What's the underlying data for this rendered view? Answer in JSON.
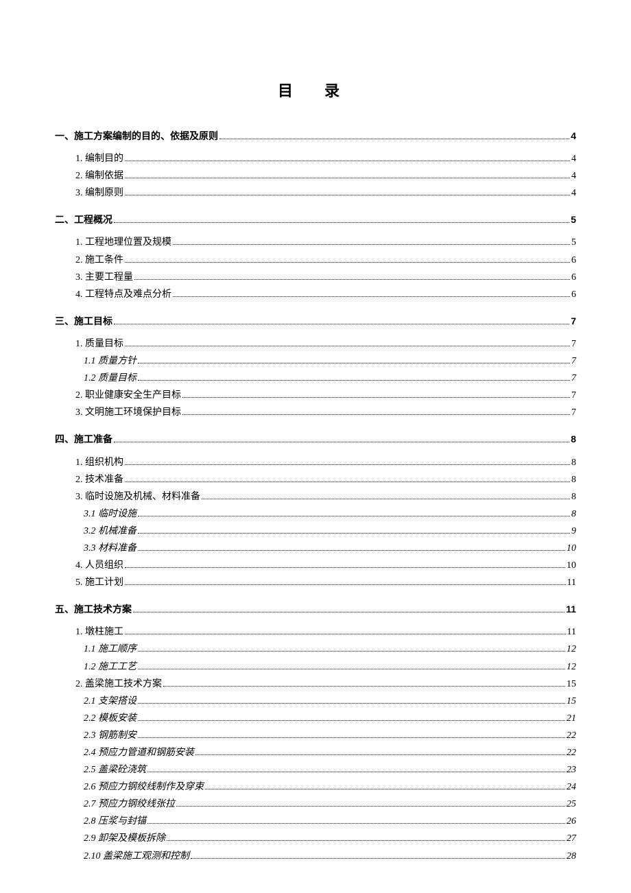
{
  "title": "目 录",
  "toc": [
    {
      "level": 1,
      "label": "一、施工方案编制的目的、依据及原则",
      "page": "4"
    },
    {
      "level": 2,
      "label": "1. 编制目的",
      "page": "4"
    },
    {
      "level": 2,
      "label": "2. 编制依据",
      "page": "4"
    },
    {
      "level": 2,
      "label": "3. 编制原则",
      "page": "4"
    },
    {
      "level": 1,
      "label": "二、工程概况",
      "page": "5"
    },
    {
      "level": 2,
      "label": "1. 工程地理位置及规模",
      "page": "5"
    },
    {
      "level": 2,
      "label": "2. 施工条件",
      "page": "6"
    },
    {
      "level": 2,
      "label": "3. 主要工程量",
      "page": "6"
    },
    {
      "level": 2,
      "label": "4. 工程特点及难点分析",
      "page": "6"
    },
    {
      "level": 1,
      "label": "三、施工目标",
      "page": "7"
    },
    {
      "level": 2,
      "label": "1. 质量目标",
      "page": "7"
    },
    {
      "level": 3,
      "label": "1.1 质量方针",
      "page": "7"
    },
    {
      "level": 3,
      "label": "1.2 质量目标",
      "page": "7"
    },
    {
      "level": 2,
      "label": "2. 职业健康安全生产目标",
      "page": "7"
    },
    {
      "level": 2,
      "label": "3. 文明施工环境保护目标",
      "page": "7"
    },
    {
      "level": 1,
      "label": "四、施工准备",
      "page": "8"
    },
    {
      "level": 2,
      "label": "1. 组织机构",
      "page": "8"
    },
    {
      "level": 2,
      "label": "2. 技术准备",
      "page": "8"
    },
    {
      "level": 2,
      "label": "3. 临时设施及机械、材料准备",
      "page": "8"
    },
    {
      "level": 3,
      "label": "3.1 临时设施",
      "page": "8"
    },
    {
      "level": 3,
      "label": "3.2 机械准备",
      "page": "9"
    },
    {
      "level": 3,
      "label": "3.3 材料准备",
      "page": "10"
    },
    {
      "level": 2,
      "label": "4. 人员组织",
      "page": "10"
    },
    {
      "level": 2,
      "label": "5. 施工计划",
      "page": "11"
    },
    {
      "level": 1,
      "label": "五、施工技术方案",
      "page": "11"
    },
    {
      "level": 2,
      "label": "1. 墩柱施工",
      "page": "11"
    },
    {
      "level": 3,
      "label": "1.1 施工顺序",
      "page": "12"
    },
    {
      "level": 3,
      "label": "1.2 施工工艺",
      "page": "12"
    },
    {
      "level": 2,
      "label": "2. 盖梁施工技术方案",
      "page": "15"
    },
    {
      "level": 3,
      "label": "2.1 支架搭设",
      "page": "15"
    },
    {
      "level": 3,
      "label": "2.2 模板安装",
      "page": "21"
    },
    {
      "level": 3,
      "label": "2.3 钢筋制安",
      "page": "22"
    },
    {
      "level": 3,
      "label": "2.4 预应力管道和钢筋安装",
      "page": "22"
    },
    {
      "level": 3,
      "label": "2.5 盖梁砼浇筑",
      "page": "23"
    },
    {
      "level": 3,
      "label": "2.6 预应力钢绞线制作及穿束",
      "page": "24"
    },
    {
      "level": 3,
      "label": "2.7 预应力钢绞线张拉",
      "page": "25"
    },
    {
      "level": 3,
      "label": "2.8 压浆与封锚",
      "page": "26"
    },
    {
      "level": 3,
      "label": "2.9 卸架及模板拆除",
      "page": "27"
    },
    {
      "level": 3,
      "label": "2.10 盖梁施工观测和控制",
      "page": "28"
    }
  ]
}
